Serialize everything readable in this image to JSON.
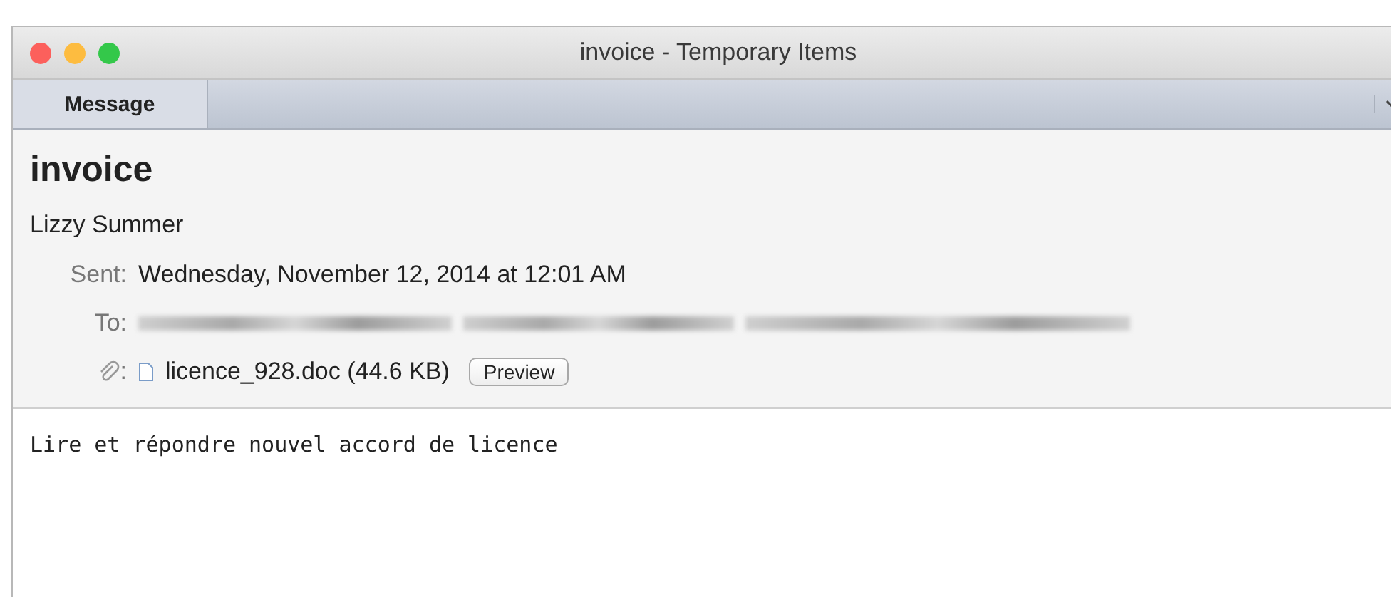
{
  "window": {
    "title": "invoice - Temporary Items"
  },
  "toolbar": {
    "tabs": [
      {
        "label": "Message",
        "selected": true
      }
    ]
  },
  "message": {
    "subject": "invoice",
    "sender": "Lizzy Summer",
    "sent_label": "Sent:",
    "sent_value": "Wednesday, November 12, 2014 at 12:01 AM",
    "to_label": "To:",
    "attachment_label": ":",
    "attachment_name": "licence_928.doc (44.6 KB)",
    "preview_button": "Preview"
  },
  "body": "Lire et répondre nouvel accord de licence"
}
